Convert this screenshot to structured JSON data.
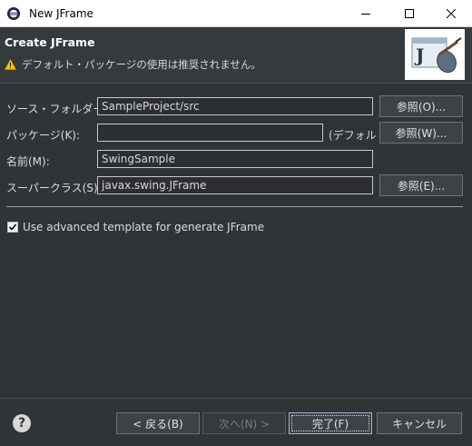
{
  "window": {
    "title": "New JFrame"
  },
  "banner": {
    "title": "Create JFrame",
    "warning": "デフォルト・パッケージの使用は推奨されません。"
  },
  "form": {
    "source_folder": {
      "label": "ソース・フォルダー(D):",
      "value": "SampleProject/src",
      "browse": "参照(O)..."
    },
    "package": {
      "label": "パッケージ(K):",
      "value": "",
      "default_hint": "(デフォルト)",
      "browse": "参照(W)..."
    },
    "name": {
      "label": "名前(M):",
      "value": "SwingSample"
    },
    "superclass": {
      "label": "スーパークラス(S):",
      "value": "javax.swing.JFrame",
      "browse": "参照(E)..."
    },
    "advanced": {
      "label": "Use advanced template for generate JFrame",
      "checked": true
    }
  },
  "footer": {
    "back": "< 戻る(B)",
    "next": "次へ(N) >",
    "finish": "完了(F)",
    "cancel": "キャンセル"
  },
  "icons": [
    "eclipse-app-icon",
    "minimize-icon",
    "maximize-icon",
    "close-icon",
    "warning-icon",
    "jframe-wizard-icon",
    "help-icon",
    "checkbox-checked-icon"
  ],
  "colors": {
    "background": "#2f3437",
    "warning": "#f2c500",
    "banner_image_bg": "#ffffff"
  }
}
